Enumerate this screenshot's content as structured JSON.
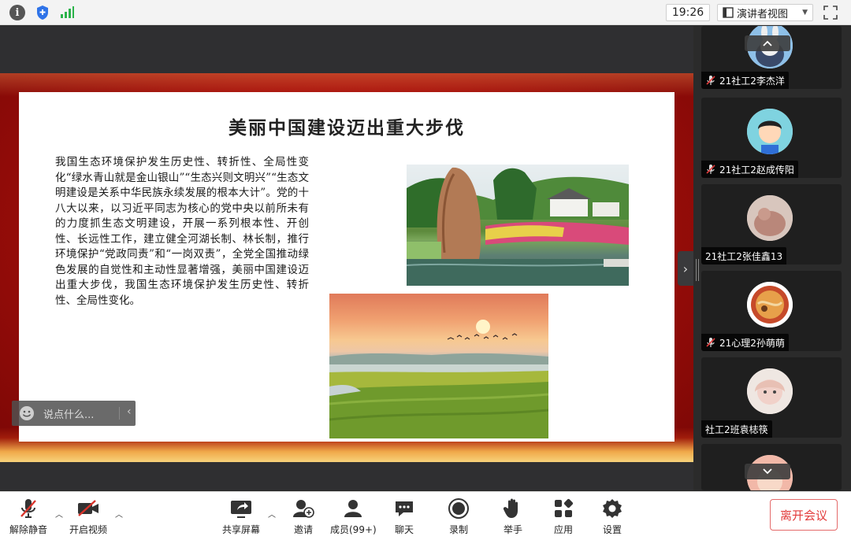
{
  "topbar": {
    "clock": "19:26",
    "view_mode": "演讲者视图"
  },
  "slide": {
    "title": "美丽中国建设迈出重大步伐",
    "body": "我国生态环境保护发生历史性、转折性、全局性变化“绿水青山就是金山银山”“生态兴则文明兴”“生态文明建设是关系中华民族永续发展的根本大计”。党的十八大以来，以习近平同志为核心的党中央以前所未有的力度抓生态文明建设，开展一系列根本性、开创性、长远性工作，建立健全河湖长制、林长制，推行环境保护“党政同责”和“一岗双责”，全党全国推动绿色发展的自觉性和主动性显著增强，美丽中国建设迈出重大步伐，我国生态环境保护发生历史性、转折性、全局性变化。"
  },
  "chat": {
    "placeholder": "说点什么..."
  },
  "participants": [
    {
      "name": "21社工2李杰洋",
      "muted": true
    },
    {
      "name": "21社工2赵成传阳",
      "muted": true
    },
    {
      "name": "21社工2张佳鑫13",
      "muted": false
    },
    {
      "name": "21心理2孙萌萌",
      "muted": true
    },
    {
      "name": "社工2班袁梽筷",
      "muted": false
    }
  ],
  "toolbar": {
    "unmute": "解除静音",
    "start_video": "开启视频",
    "share_screen": "共享屏幕",
    "invite": "邀请",
    "members": "成员(99+)",
    "chat": "聊天",
    "record": "录制",
    "raise_hand": "举手",
    "apps": "应用",
    "settings": "设置",
    "leave": "离开会议"
  },
  "colors": {
    "slide_bg": "#a50f0b",
    "leave_red": "#e23b3b",
    "mute_red": "#d9342b"
  }
}
